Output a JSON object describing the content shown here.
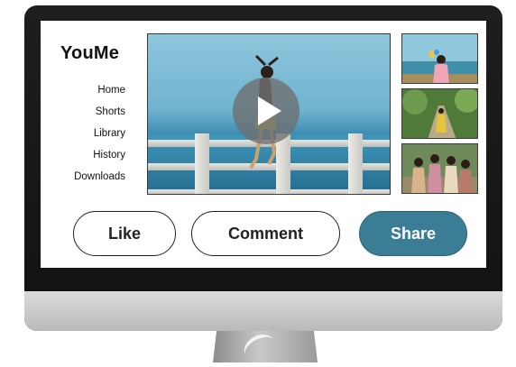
{
  "app": {
    "title": "YouMe"
  },
  "sidebar": {
    "items": [
      {
        "label": "Home"
      },
      {
        "label": "Shorts"
      },
      {
        "label": "Library"
      },
      {
        "label": "History"
      },
      {
        "label": "Downloads"
      }
    ]
  },
  "player": {
    "play_icon": "play-icon"
  },
  "thumbnails": [
    {
      "icon": "video-thumbnail"
    },
    {
      "icon": "video-thumbnail"
    },
    {
      "icon": "video-thumbnail"
    }
  ],
  "actions": {
    "like_label": "Like",
    "comment_label": "Comment",
    "share_label": "Share"
  },
  "colors": {
    "share_button": "#3a7d94",
    "monitor_bezel": "#1a1a1a",
    "monitor_chin": "#c8c8c8"
  }
}
